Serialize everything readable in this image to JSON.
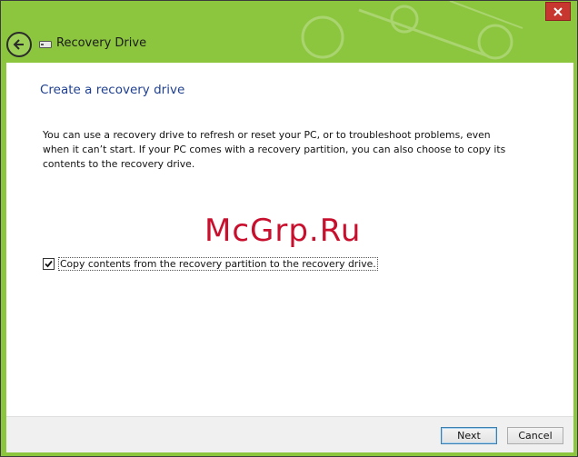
{
  "window": {
    "title": "Recovery Drive",
    "accent_color": "#8cc63f",
    "close_icon": "close-icon",
    "back_icon": "back-arrow-icon",
    "title_icon": "drive-icon"
  },
  "main": {
    "heading": "Create a recovery drive",
    "description": "You can use a recovery drive to refresh or reset your PC, or to troubleshoot problems, even when it can’t start. If your PC comes with a recovery partition, you can also choose to copy its contents to the recovery drive.",
    "watermark": "McGrp.Ru",
    "checkbox": {
      "label": "Copy contents from the recovery partition to the recovery drive.",
      "checked": true
    }
  },
  "footer": {
    "next_label": "Next",
    "cancel_label": "Cancel"
  }
}
